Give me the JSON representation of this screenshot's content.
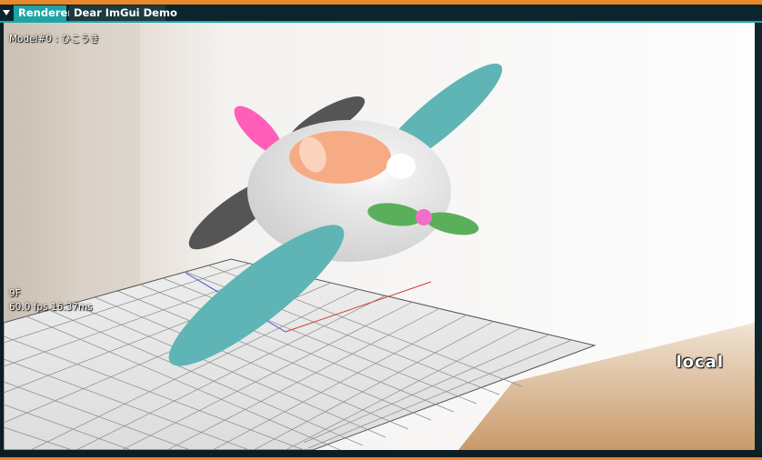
{
  "tabs": [
    {
      "label": "Renderer",
      "active": true
    },
    {
      "label": "Dear ImGui Demo",
      "active": false
    }
  ],
  "menu_icon": "triangle-down-icon",
  "viewport": {
    "model_label": "Model#0 : ひこうき",
    "frame_label": "9F",
    "fps_label": "60.0 fps 16.37ms",
    "space_label": "local"
  },
  "colors": {
    "window_border": "#e8882a",
    "tab_active": "#1fa3a7",
    "tab_inactive": "#1b3b40",
    "wing": "#5fb5b5",
    "body": "#e2e2e2",
    "canopy": "#f7ab85",
    "tail_fin": "#ff5fb8",
    "propeller": "#5ab05a",
    "spinner": "#f26ec8",
    "rear_wing": "#555555"
  }
}
